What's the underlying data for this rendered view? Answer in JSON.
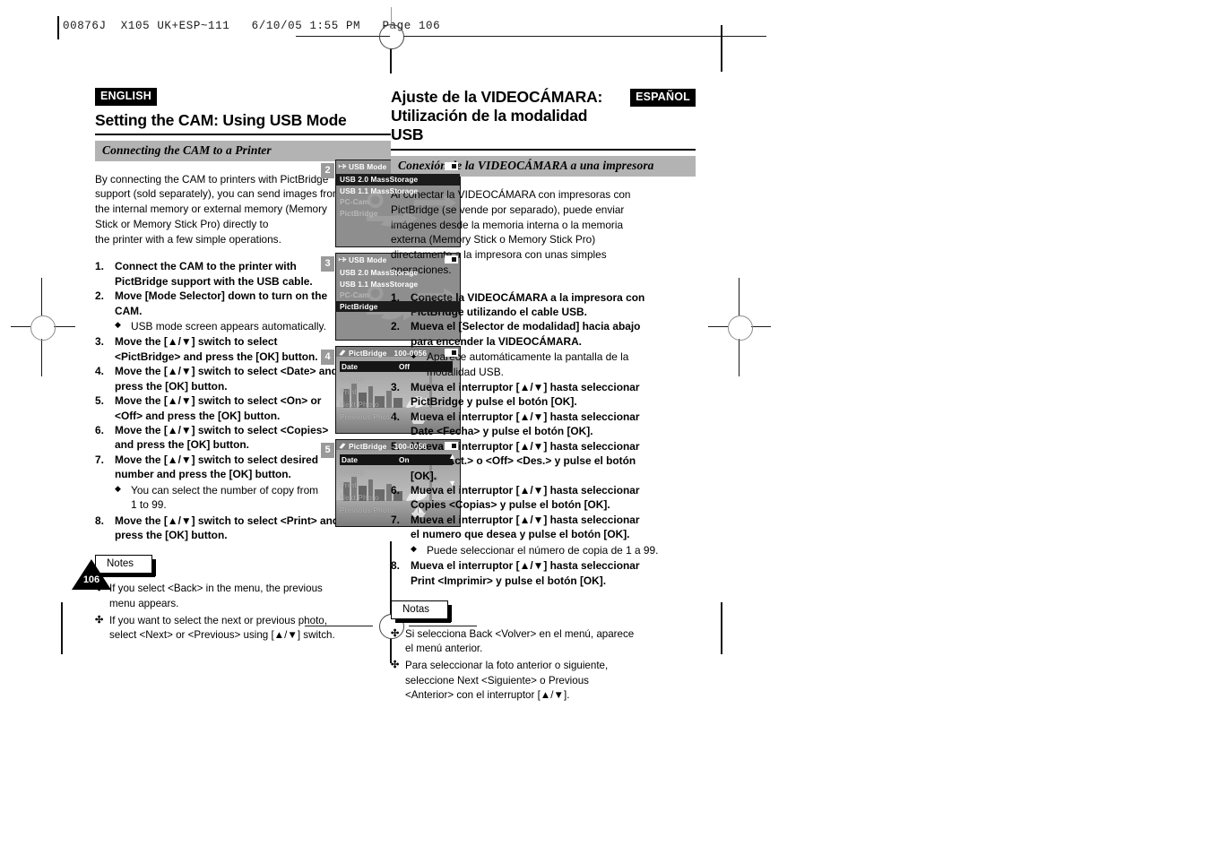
{
  "proof": {
    "header": "00876J  X105 UK+ESP~111   6/10/05 1:55 PM   Page 106"
  },
  "english": {
    "lang_tag": "ENGLISH",
    "title_line1": "Setting the CAM: Using USB Mode",
    "subhead": "Connecting the CAM to a Printer",
    "intro": [
      "By connecting the CAM to printers with PictBridge",
      "support (sold separately), you can send images from",
      "the internal memory or external memory (Memory",
      "Stick or Memory Stick Pro) directly to",
      "the printer with a few simple operations."
    ],
    "steps": [
      {
        "num": "1.",
        "lines": [
          "Connect the CAM to the printer with",
          "PictBridge support with the USB cable."
        ],
        "sub": []
      },
      {
        "num": "2.",
        "lines": [
          "Move [Mode Selector] down to turn on the",
          "CAM."
        ],
        "sub": [
          [
            "USB mode screen appears automatically."
          ]
        ]
      },
      {
        "num": "3.",
        "lines": [
          "Move the [▲/▼] switch to select",
          "<PictBridge> and press the [OK] button."
        ],
        "sub": []
      },
      {
        "num": "4.",
        "lines": [
          "Move the [▲/▼] switch to select <Date> and",
          "press the [OK] button."
        ],
        "sub": []
      },
      {
        "num": "5.",
        "lines": [
          "Move the [▲/▼] switch to select <On> or",
          "<Off> and press the [OK] button."
        ],
        "sub": []
      },
      {
        "num": "6.",
        "lines": [
          "Move the [▲/▼] switch to select <Copies>",
          "and press the [OK] button."
        ],
        "sub": []
      },
      {
        "num": "7.",
        "lines": [
          "Move the [▲/▼] switch to select desired",
          "number and press the [OK] button."
        ],
        "sub": [
          [
            "You can select the number of copy from",
            "1 to 99."
          ]
        ]
      },
      {
        "num": "8.",
        "lines": [
          "Move the [▲/▼] switch to select <Print> and",
          "press the [OK] button."
        ],
        "sub": []
      }
    ],
    "notes_label": "Notes",
    "notes": [
      [
        "If you select <Back> in the menu, the previous",
        "menu appears."
      ],
      [
        "If you want to select the next or previous photo,",
        "select <Next> or <Previous> using [▲/▼] switch."
      ]
    ],
    "page_number": "106"
  },
  "spanish": {
    "lang_tag": "ESPAÑOL",
    "title_line1": "Ajuste de la VIDEOCÁMARA:",
    "title_line2": "Utilización de la modalidad USB",
    "subhead": "Conexión de la VIDEOCÁMARA a una impresora",
    "intro": [
      "Al conectar la VIDEOCÁMARA con impresoras con",
      "PictBridge (se vende por separado), puede enviar",
      "imágenes desde la memoria interna o la memoria",
      "externa (Memory Stick o Memory Stick Pro)",
      "directamente a la impresora con unas simples",
      "operaciones."
    ],
    "steps": [
      {
        "num": "1.",
        "lines": [
          "Conecte la VIDEOCÁMARA a la impresora con",
          "PictBridge utilizando el cable USB."
        ],
        "sub": []
      },
      {
        "num": "2.",
        "lines": [
          "Mueva el [Selector de modalidad] hacia abajo",
          "para encender la VIDEOCÁMARA."
        ],
        "sub": [
          [
            "Aparece automáticamente la pantalla de la",
            "modalidad USB."
          ]
        ]
      },
      {
        "num": "3.",
        "lines": [
          "Mueva el interruptor [▲/▼] hasta seleccionar",
          "PictBridge y pulse el botón [OK]."
        ],
        "sub": []
      },
      {
        "num": "4.",
        "lines": [
          "Mueva el interruptor [▲/▼] hasta seleccionar",
          "Date <Fecha> y pulse el botón [OK]."
        ],
        "sub": []
      },
      {
        "num": "5.",
        "lines": [
          "Mueva el interruptor [▲/▼] hasta seleccionar",
          "<On> <Act.> o <Off> <Des.> y pulse el botón",
          "[OK]."
        ],
        "sub": []
      },
      {
        "num": "6.",
        "lines": [
          "Mueva el interruptor [▲/▼] hasta seleccionar",
          "Copies <Copias> y pulse el botón [OK]."
        ],
        "sub": []
      },
      {
        "num": "7.",
        "lines": [
          "Mueva el interruptor [▲/▼] hasta seleccionar",
          "el numero que desea y pulse el botón [OK]."
        ],
        "sub": [
          [
            "Puede seleccionar el número de copia de 1 a 99."
          ]
        ]
      },
      {
        "num": "8.",
        "lines": [
          "Mueva el interruptor [▲/▼] hasta seleccionar",
          "Print <Imprimir> y pulse el botón [OK]."
        ],
        "sub": []
      }
    ],
    "notes_label": "Notas",
    "notes": [
      [
        "Si selecciona Back <Volver> en el menú, aparece",
        "el menú anterior."
      ],
      [
        "Para seleccionar la foto anterior o siguiente,",
        "seleccione Next <Siguiente> o Previous",
        "<Anterior> con el interruptor [▲/▼]."
      ]
    ]
  },
  "panels": [
    {
      "badge": "2",
      "type": "menu",
      "title": "USB Mode",
      "title_icon": "usb-icon",
      "items": [
        {
          "label": "USB 2.0 MassStorage",
          "state": "selected"
        },
        {
          "label": "USB 1.1 MassStorage",
          "state": "normal"
        },
        {
          "label": "PC-Cam",
          "state": "dim"
        },
        {
          "label": "PictBridge",
          "state": "dim"
        }
      ]
    },
    {
      "badge": "3",
      "type": "menu",
      "title": "USB Mode",
      "title_icon": "usb-icon",
      "items": [
        {
          "label": "USB 2.0 MassStorage",
          "state": "normal"
        },
        {
          "label": "USB 1.1 MassStorage",
          "state": "normal"
        },
        {
          "label": "PC-Cam",
          "state": "dim"
        },
        {
          "label": "PictBridge",
          "state": "selected"
        }
      ]
    },
    {
      "badge": "4",
      "type": "pictbridge",
      "title": "PictBridge",
      "title_icon": "printer-icon",
      "counter": "100-0056",
      "date_label": "Date",
      "date_value": "Off",
      "ghost_items": [
        "Copies",
        "Print",
        "Next Photo",
        "Previous Photo"
      ],
      "arrows": false
    },
    {
      "badge": "5",
      "type": "pictbridge",
      "title": "PictBridge",
      "title_icon": "printer-icon",
      "counter": "100-0056",
      "date_label": "Date",
      "date_value": "On",
      "ghost_items": [
        "Copies",
        "Print",
        "Next Photo",
        "Previous Photo"
      ],
      "arrows": true
    }
  ]
}
